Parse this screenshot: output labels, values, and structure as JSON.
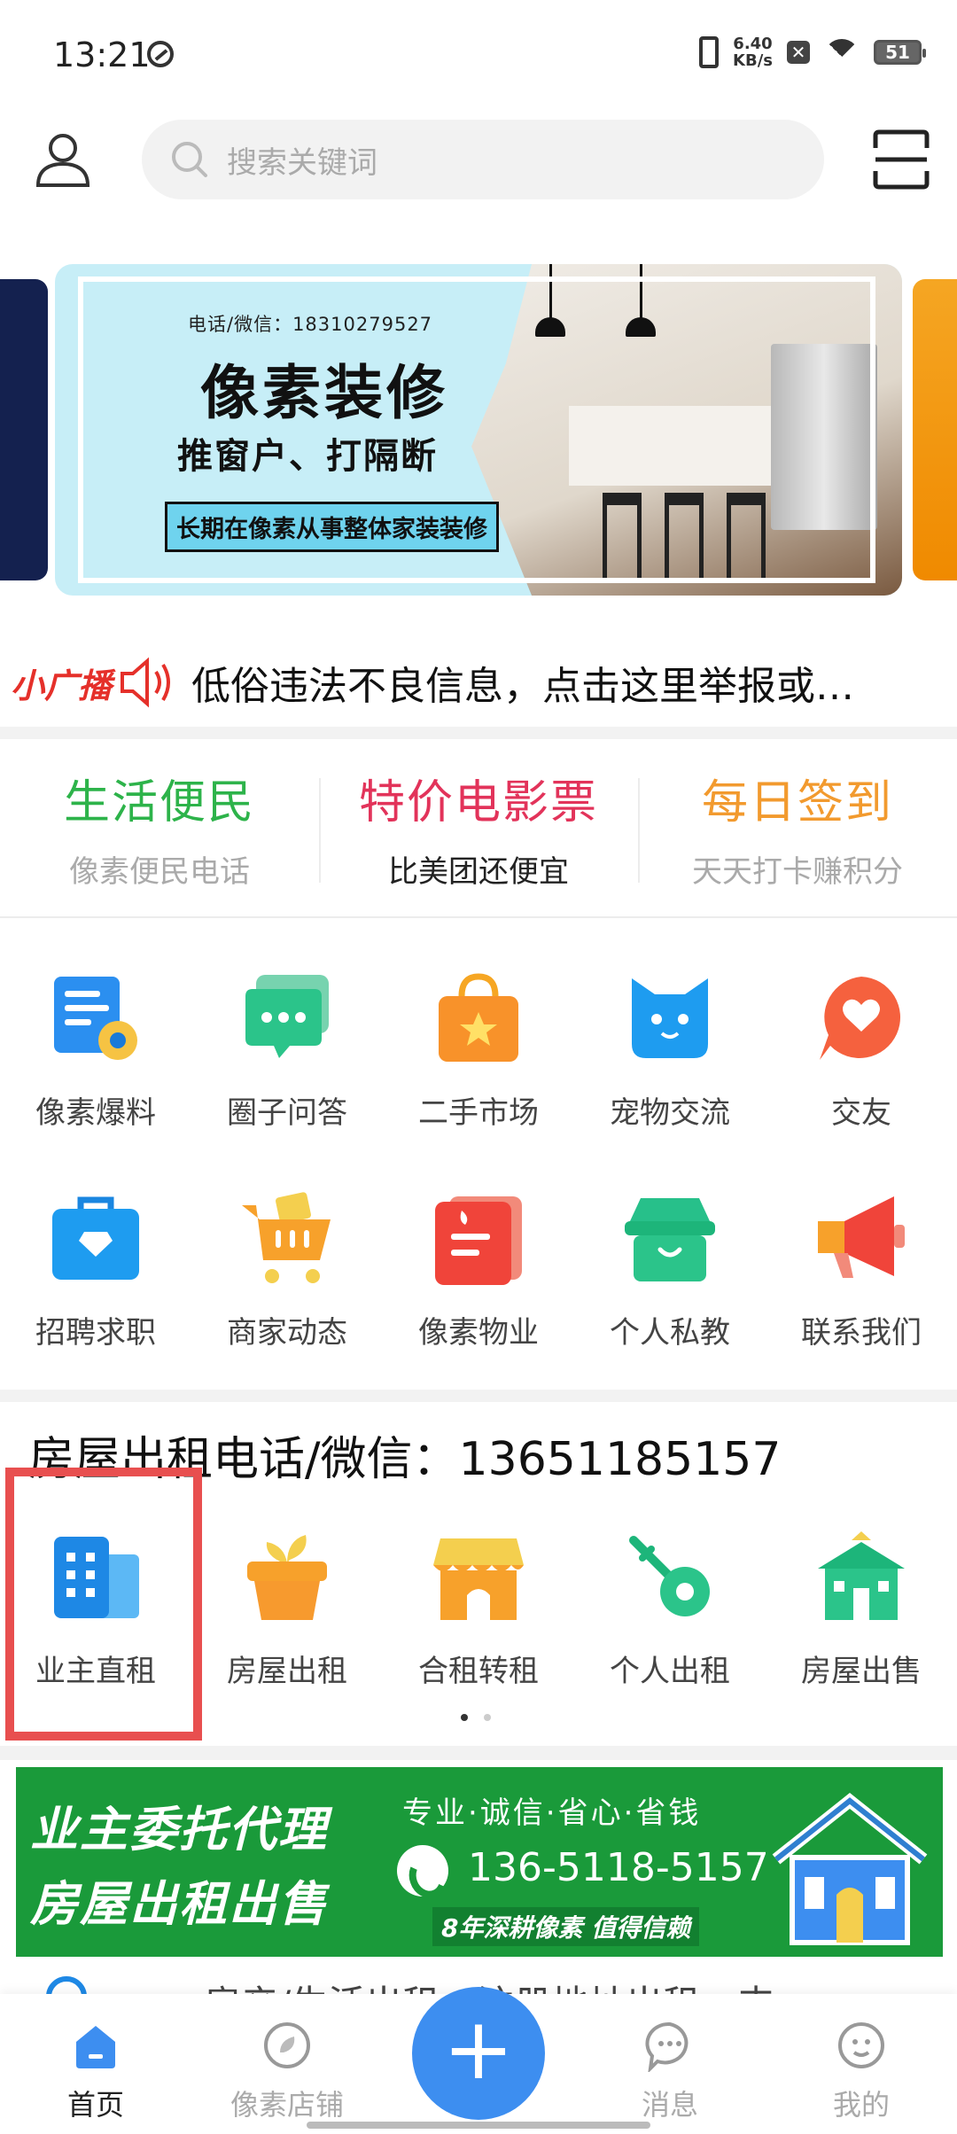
{
  "status_bar": {
    "time": "13:21",
    "speed_value": "6.40",
    "speed_unit": "KB/s",
    "battery": "51"
  },
  "search": {
    "placeholder": "搜索关键词"
  },
  "banner": {
    "phone": "电话/微信：18310279527",
    "title": "像素装修",
    "subtitle": "推窗户、打隔断",
    "tag": "长期在像素从事整体家装装修"
  },
  "notice": {
    "brand": "小广播",
    "text": "低俗违法不良信息，点击这里举报或…"
  },
  "promos": [
    {
      "title": "生活便民",
      "subtitle": "像素便民电话",
      "color": "#2db34a"
    },
    {
      "title": "特价电影票",
      "subtitle": "比美团还便宜",
      "color": "#e2335a"
    },
    {
      "title": "每日签到",
      "subtitle": "天天打卡赚积分",
      "color": "#f29a2e"
    }
  ],
  "grid_row1": [
    {
      "label": "像素爆料",
      "icon": "news-icon"
    },
    {
      "label": "圈子问答",
      "icon": "chat-bubble-icon"
    },
    {
      "label": "二手市场",
      "icon": "shopping-bag-icon"
    },
    {
      "label": "宠物交流",
      "icon": "cat-icon"
    },
    {
      "label": "交友",
      "icon": "heart-bubble-icon"
    }
  ],
  "grid_row2": [
    {
      "label": "招聘求职",
      "icon": "briefcase-icon"
    },
    {
      "label": "商家动态",
      "icon": "shopping-cart-icon"
    },
    {
      "label": "像素物业",
      "icon": "document-icon"
    },
    {
      "label": "个人私教",
      "icon": "box-smile-icon"
    },
    {
      "label": "联系我们",
      "icon": "megaphone-icon"
    }
  ],
  "house": {
    "title": "房屋出租电话/微信：13651185157",
    "items": [
      {
        "label": "业主直租",
        "icon": "building-icon"
      },
      {
        "label": "房屋出租",
        "icon": "sprout-pot-icon"
      },
      {
        "label": "合租转租",
        "icon": "storefront-icon"
      },
      {
        "label": "个人出租",
        "icon": "key-icon"
      },
      {
        "label": "房屋出售",
        "icon": "house-icon"
      }
    ]
  },
  "green_banner": {
    "line1": "业主委托代理",
    "line2": "房屋出租出售",
    "slogan": "专业·诚信·省心·省钱",
    "phone": "136-5118-5157",
    "tag": "8年深耕像素 值得信赖"
  },
  "ticker": {
    "text": "房产/生活出租、注册地址出租、丰"
  },
  "nav": [
    {
      "label": "首页",
      "icon": "home-icon",
      "active": true
    },
    {
      "label": "像素店铺",
      "icon": "shop-icon",
      "active": false
    },
    {
      "label": "",
      "icon": "plus-icon",
      "active": false
    },
    {
      "label": "消息",
      "icon": "message-icon",
      "active": false
    },
    {
      "label": "我的",
      "icon": "profile-icon",
      "active": false
    }
  ]
}
